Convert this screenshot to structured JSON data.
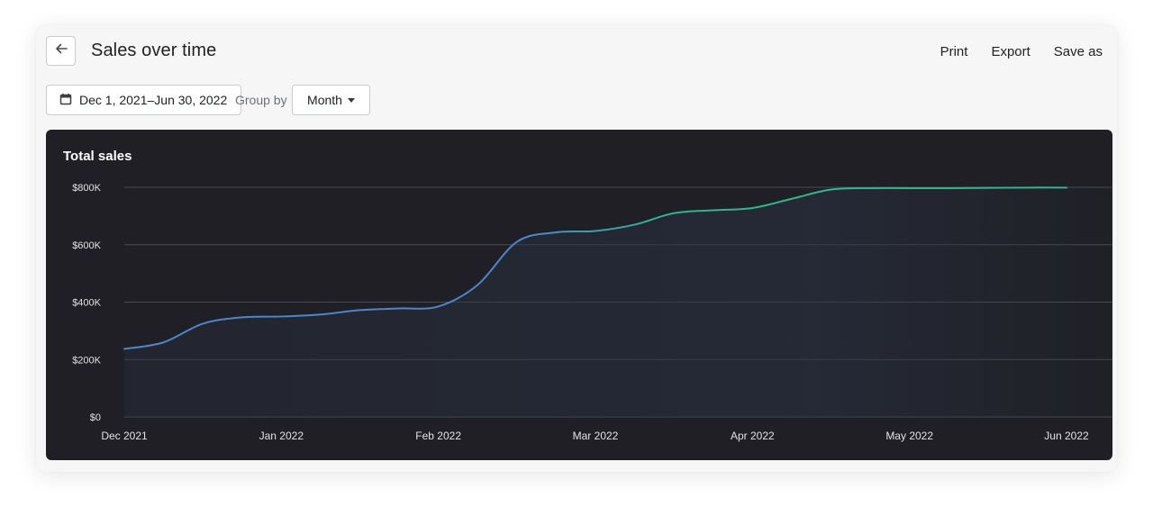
{
  "header": {
    "title": "Sales over time",
    "actions": [
      "Print",
      "Export",
      "Save as"
    ]
  },
  "filters": {
    "date_range": "Dec 1, 2021–Jun 30, 2022",
    "group_by_label": "Group by",
    "group_by_value": "Month"
  },
  "icons": {
    "back": "arrow-left-icon",
    "calendar": "calendar-icon",
    "dropdown": "caret-down-icon"
  },
  "colors": {
    "line_start": "#4b86c8",
    "line_end": "#2eb88a",
    "panel_bg": "#1f1f25"
  },
  "chart_data": {
    "type": "line",
    "title": "Total sales",
    "categories": [
      "Dec 2021",
      "Jan 2022",
      "Feb 2022",
      "Mar 2022",
      "Apr 2022",
      "May 2022",
      "Jun 2022"
    ],
    "x": [
      0,
      0.25,
      0.5,
      0.75,
      1.0,
      1.25,
      1.5,
      1.75,
      2.0,
      2.25,
      2.5,
      2.75,
      3.0,
      3.25,
      3.5,
      3.75,
      4.0,
      4.25,
      4.5,
      4.75,
      5.0,
      5.25,
      5.5,
      5.75,
      6.0
    ],
    "series": [
      {
        "values": [
          237000,
          260000,
          325000,
          347000,
          350000,
          357000,
          372000,
          378000,
          385000,
          460000,
          610000,
          643000,
          648000,
          670000,
          710000,
          720000,
          728000,
          760000,
          792000,
          797000,
          797000,
          797000,
          798000,
          799000,
          799000
        ]
      }
    ],
    "ylim": [
      0,
      800000
    ],
    "yticks": [
      "$800K",
      "$600K",
      "$400K",
      "$200K",
      "$0"
    ],
    "ytick_values": [
      800000,
      600000,
      400000,
      200000,
      0
    ],
    "grid": true,
    "legend": "none"
  }
}
